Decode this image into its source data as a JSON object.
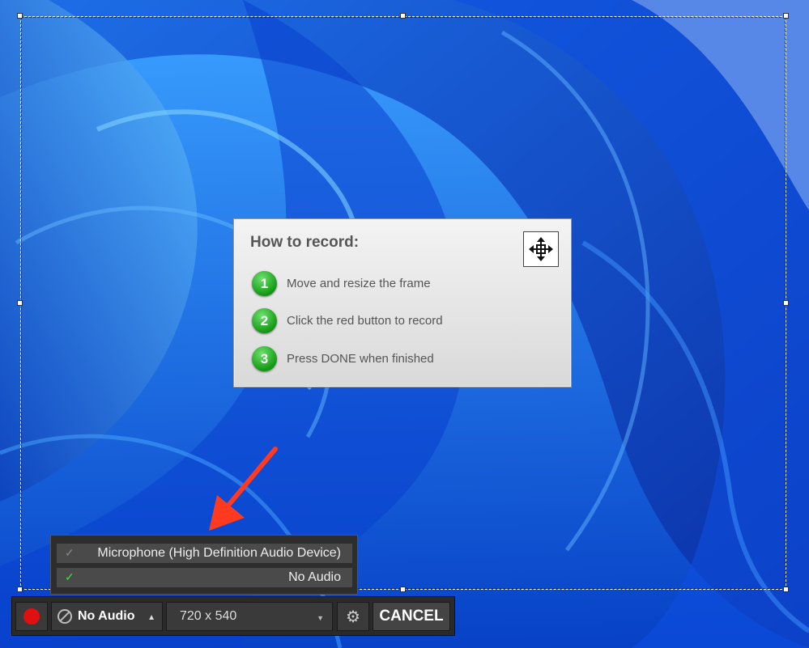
{
  "howto": {
    "title": "How to record:",
    "steps": [
      {
        "num": "1",
        "text": "Move and resize the frame"
      },
      {
        "num": "2",
        "text": "Click the red button to record"
      },
      {
        "num": "3",
        "text": "Press DONE when finished"
      }
    ]
  },
  "audio_menu": {
    "items": [
      {
        "label": "Microphone (High Definition Audio Device)",
        "checked": false
      },
      {
        "label": "No Audio",
        "checked": true
      }
    ]
  },
  "toolbar": {
    "audio_label": "No Audio",
    "size_label": "720 x 540",
    "cancel_label": "CANCEL"
  },
  "icons": {
    "record": "record-dot-icon",
    "mute": "no-audio-icon",
    "gear": "gear-icon",
    "move": "move-arrows-icon",
    "check": "checkmark-icon"
  },
  "colors": {
    "record": "#e01010",
    "step_badge": "#149a14",
    "annotation_arrow": "#ff3a1f"
  }
}
